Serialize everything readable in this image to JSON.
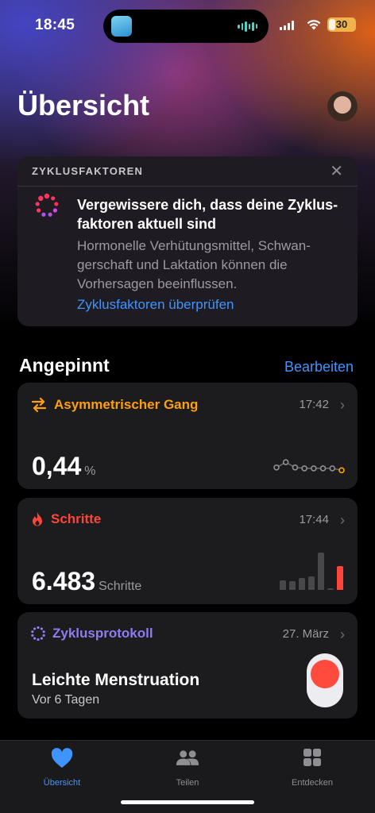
{
  "status": {
    "time": "18:45",
    "battery": "30"
  },
  "header": {
    "title": "Übersicht"
  },
  "cycle_factors": {
    "label": "ZYKLUSFAKTOREN",
    "close_icon": "close-icon",
    "heading": "Vergewissere dich, dass deine Zyklus-faktoren aktuell sind",
    "body": "Hormonelle Verhütungsmittel, Schwan-gerschaft und Laktation können die Vorhersagen beeinflussen.",
    "link": "Zyklusfaktoren überprüfen"
  },
  "pinned": {
    "title": "Angepinnt",
    "edit": "Bearbeiten",
    "tiles": [
      {
        "title": "Asymmetrischer Gang",
        "time": "17:42",
        "value": "0,44",
        "unit": "%",
        "color": "#ff9f0a",
        "icon": "arrows-icon",
        "trend": [
          0.6,
          0.9,
          0.6,
          0.55,
          0.55,
          0.55,
          0.55,
          0.44
        ]
      },
      {
        "title": "Schritte",
        "time": "17:44",
        "value": "6.483",
        "unit": "Schritte",
        "color": "#ff453a",
        "icon": "flame-icon",
        "bars": [
          0.25,
          0.22,
          0.3,
          0.35,
          0.95,
          0.05,
          0.6
        ]
      },
      {
        "title": "Zyklusprotokoll",
        "time": "27. März",
        "status": "Leichte Menstruation",
        "sub": "Vor 6 Tagen",
        "color": "#8e7cf0",
        "icon": "cycle-icon"
      }
    ]
  },
  "tabbar": {
    "items": [
      {
        "label": "Übersicht",
        "icon": "heart-icon",
        "active": true
      },
      {
        "label": "Teilen",
        "icon": "people-icon",
        "active": false
      },
      {
        "label": "Entdecken",
        "icon": "grid-icon",
        "active": false
      }
    ]
  }
}
